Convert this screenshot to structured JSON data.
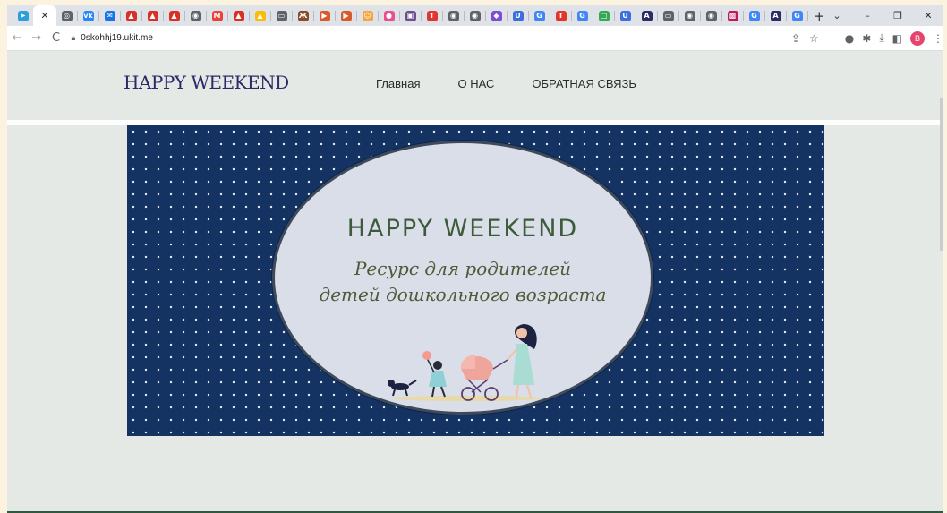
{
  "browser": {
    "tabs": [
      {
        "icon": "telegram-icon",
        "color": "#2a9fd9",
        "glyph": "➤"
      },
      {
        "icon": "close-icon",
        "active": true
      },
      {
        "icon": "circle-icon",
        "color": "#5f6368",
        "glyph": "◎"
      },
      {
        "icon": "vk-icon",
        "color": "#2787f5",
        "glyph": "vk"
      },
      {
        "icon": "mail-icon",
        "color": "#1a73e8",
        "glyph": "✉"
      },
      {
        "icon": "drive-warning-icon",
        "color": "#d93025",
        "glyph": "▲"
      },
      {
        "icon": "drive-warning-icon",
        "color": "#d93025",
        "glyph": "▲"
      },
      {
        "icon": "drive-warning-icon",
        "color": "#d93025",
        "glyph": "▲"
      },
      {
        "icon": "globe-icon",
        "color": "#5f6368",
        "glyph": "◉"
      },
      {
        "icon": "gmail-icon",
        "color": "#ea4335",
        "glyph": "M"
      },
      {
        "icon": "drive-warning-icon",
        "color": "#d93025",
        "glyph": "▲"
      },
      {
        "icon": "google-drive-icon",
        "color": "#fbbc04",
        "glyph": "▲"
      },
      {
        "icon": "window-icon",
        "color": "#5f6368",
        "glyph": "▭"
      },
      {
        "icon": "book-icon",
        "color": "#8a4b2a",
        "glyph": "Ж"
      },
      {
        "icon": "slides-icon",
        "color": "#d85a2a",
        "glyph": "▶"
      },
      {
        "icon": "slides-icon",
        "color": "#d85a2a",
        "glyph": "▶"
      },
      {
        "icon": "smile-icon",
        "color": "#f4a53b",
        "glyph": "☺"
      },
      {
        "icon": "color-ball-icon",
        "color": "#e94f8e",
        "glyph": "●"
      },
      {
        "icon": "picture-icon",
        "color": "#6b4f8f",
        "glyph": "▣"
      },
      {
        "icon": "t-red-icon",
        "color": "#e0362b",
        "glyph": "T"
      },
      {
        "icon": "globe-icon",
        "color": "#5f6368",
        "glyph": "◉"
      },
      {
        "icon": "globe-icon",
        "color": "#5f6368",
        "glyph": "◉"
      },
      {
        "icon": "canva-icon",
        "color": "#7d4bd9",
        "glyph": "◆"
      },
      {
        "icon": "u-blue-icon",
        "color": "#3b6fe0",
        "glyph": "U"
      },
      {
        "icon": "google-icon",
        "color": "#4285f4",
        "glyph": "G"
      },
      {
        "icon": "t-red-icon",
        "color": "#e0362b",
        "glyph": "T"
      },
      {
        "icon": "google-icon",
        "color": "#4285f4",
        "glyph": "G"
      },
      {
        "icon": "green-square-icon",
        "color": "#34a853",
        "glyph": "□"
      },
      {
        "icon": "u-blue-icon",
        "color": "#3b6fe0",
        "glyph": "U"
      },
      {
        "icon": "a-dark-icon",
        "color": "#2d2a66",
        "glyph": "A"
      },
      {
        "icon": "window-icon",
        "color": "#5f6368",
        "glyph": "▭"
      },
      {
        "icon": "globe-icon",
        "color": "#5f6368",
        "glyph": "◉"
      },
      {
        "icon": "globe-icon",
        "color": "#5f6368",
        "glyph": "◉"
      },
      {
        "icon": "pattern-icon",
        "color": "#c2185b",
        "glyph": "▩"
      },
      {
        "icon": "google-icon",
        "color": "#4285f4",
        "glyph": "G"
      },
      {
        "icon": "a-dark-icon",
        "color": "#2d2a66",
        "glyph": "A"
      },
      {
        "icon": "google-icon",
        "color": "#4285f4",
        "glyph": "G"
      }
    ],
    "new_tab": "+",
    "window_controls": {
      "dropdown": "⌄",
      "minimize": "–",
      "restore": "❐",
      "close": "✕"
    },
    "nav": {
      "back": "←",
      "forward": "→",
      "reload": "C"
    },
    "url": "0skohhj19.ukit.me",
    "profile_initial": "B"
  },
  "site": {
    "logo": "HAPPY WEEKEND",
    "menu": [
      "Главная",
      "О НАС",
      "ОБРАТНАЯ СВЯЗЬ"
    ],
    "banner": {
      "title": "HAPPY WEEKEND",
      "line1": "Ресурс для родителей",
      "line2": "детей дошкольного возраста"
    }
  },
  "colors": {
    "banner_bg": "#143362",
    "oval_bg": "#d9dee9",
    "logo": "#2b2966",
    "title": "#3d5a3c"
  }
}
